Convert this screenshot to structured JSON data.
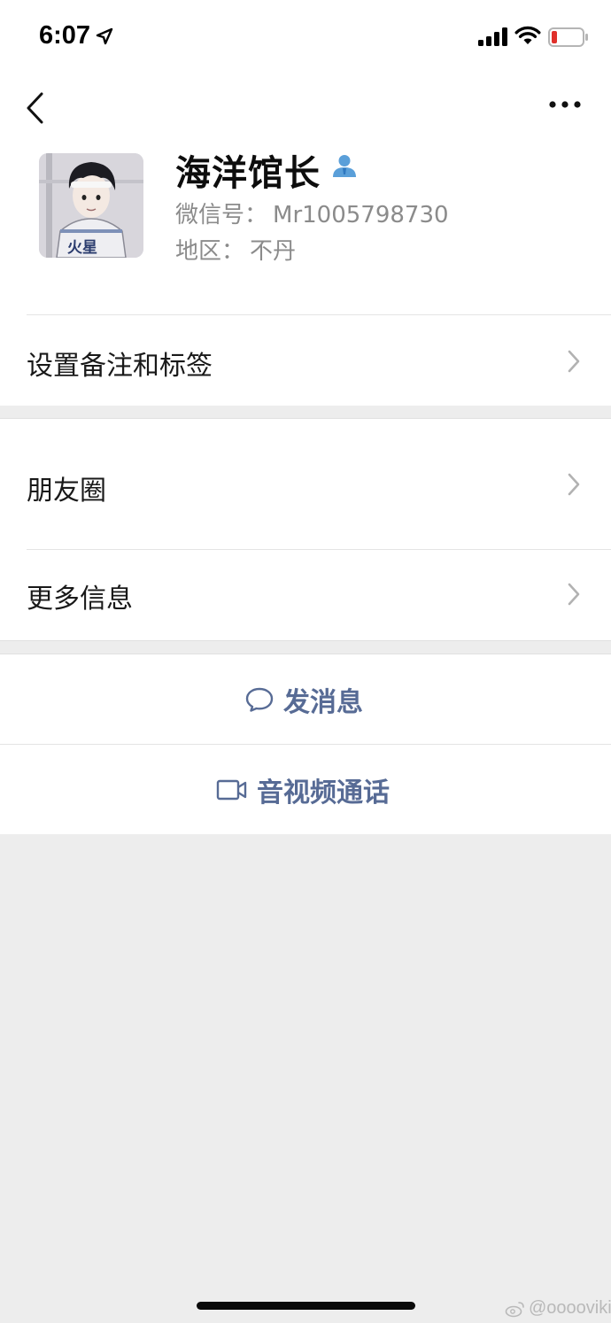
{
  "status_bar": {
    "time": "6:07"
  },
  "profile": {
    "name": "海洋馆长",
    "wechat_id_label": "微信号：",
    "wechat_id": "Mr1005798730",
    "region_label": "地区：",
    "region": "不丹",
    "avatar_text": "火星"
  },
  "menu": {
    "remarks_tags": "设置备注和标签",
    "moments": "朋友圈",
    "more_info": "更多信息"
  },
  "actions": {
    "send_message": "发消息",
    "video_call": "音视频通话"
  },
  "watermark": "@ooooviki",
  "colors": {
    "link": "#576b95",
    "background": "#ededed",
    "verify": "#5a9fd9"
  }
}
